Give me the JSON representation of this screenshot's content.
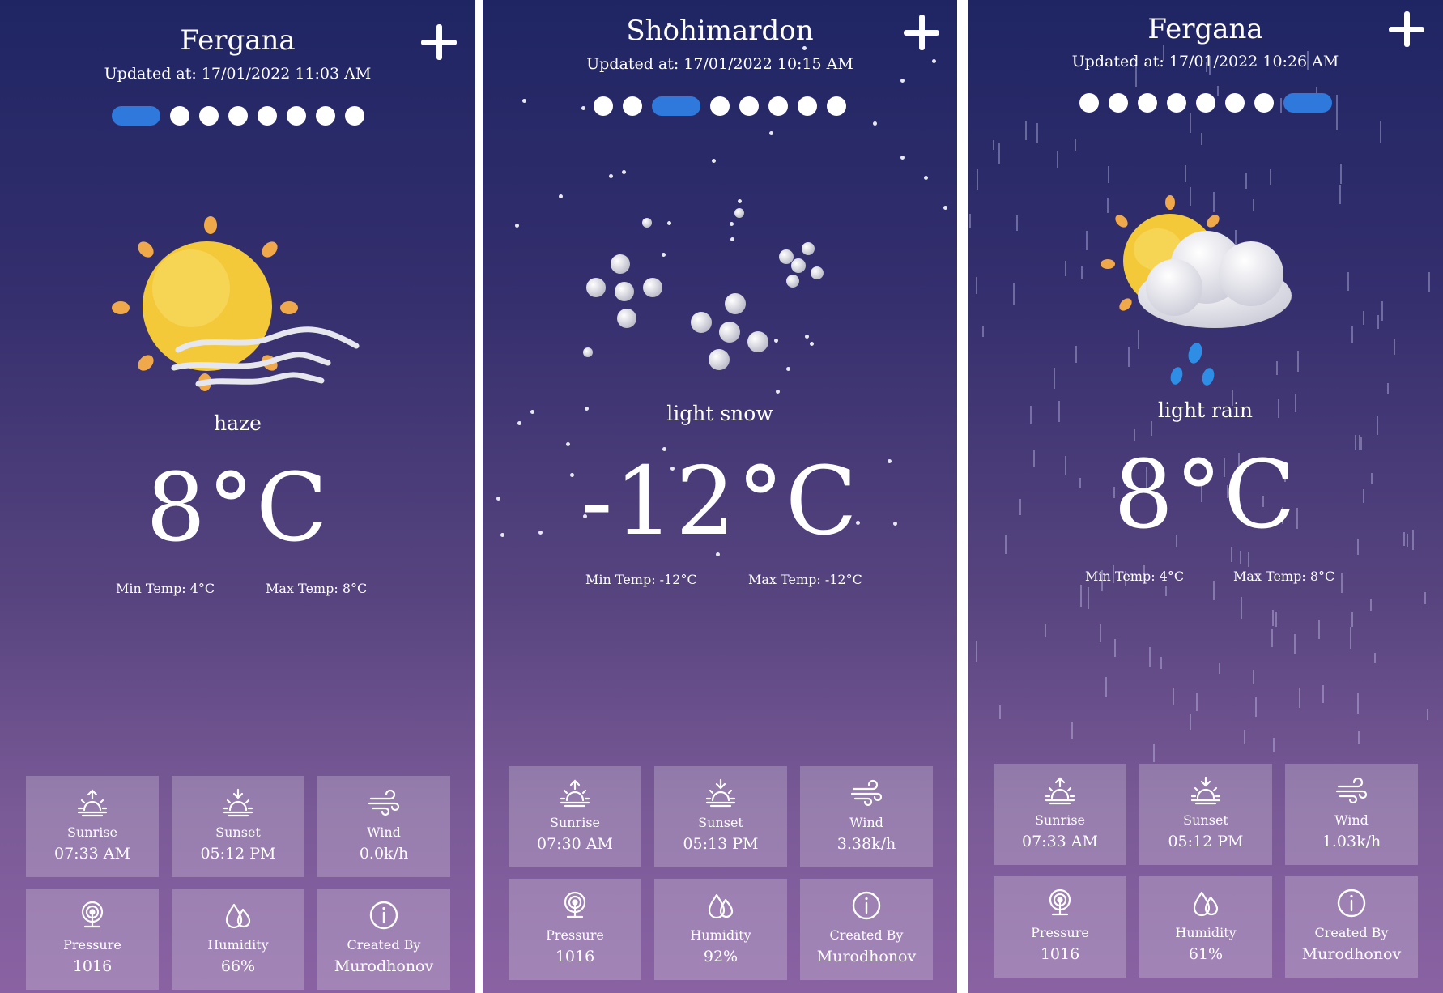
{
  "colors": {
    "active_dot": "#2e79db",
    "sun": "#f3c93a",
    "sun_ray": "#f0a94a",
    "cloud": "#e8e8ef",
    "raindrop": "#2e8ee6"
  },
  "screens": [
    {
      "city": "Fergana",
      "updated": "Updated at: 17/01/2022 11:03 AM",
      "add_icon": "plus-icon",
      "dot_count": 8,
      "active_dot_index": 0,
      "weather_icon": "sun-haze-icon",
      "condition": "haze",
      "temperature": "8°C",
      "min_temp": "Min Temp: 4°C",
      "max_temp": "Max Temp: 8°C",
      "tiles": [
        {
          "icon": "sunrise-icon",
          "label": "Sunrise",
          "value": "07:33 AM"
        },
        {
          "icon": "sunset-icon",
          "label": "Sunset",
          "value": "05:12 PM"
        },
        {
          "icon": "wind-icon",
          "label": "Wind",
          "value": "0.0k/h"
        },
        {
          "icon": "pressure-icon",
          "label": "Pressure",
          "value": "1016"
        },
        {
          "icon": "humidity-icon",
          "label": "Humidity",
          "value": "66%"
        },
        {
          "icon": "info-icon",
          "label": "Created By",
          "value": "Murodhonov"
        }
      ]
    },
    {
      "city": "Shohimardon",
      "updated": "Updated at: 17/01/2022 10:15 AM",
      "add_icon": "plus-icon",
      "dot_count": 8,
      "active_dot_index": 2,
      "weather_icon": "snow-icon",
      "condition": "light snow",
      "temperature": "-12°C",
      "min_temp": "Min Temp: -12°C",
      "max_temp": "Max Temp: -12°C",
      "tiles": [
        {
          "icon": "sunrise-icon",
          "label": "Sunrise",
          "value": "07:30 AM"
        },
        {
          "icon": "sunset-icon",
          "label": "Sunset",
          "value": "05:13 PM"
        },
        {
          "icon": "wind-icon",
          "label": "Wind",
          "value": "3.38k/h"
        },
        {
          "icon": "pressure-icon",
          "label": "Pressure",
          "value": "1016"
        },
        {
          "icon": "humidity-icon",
          "label": "Humidity",
          "value": "92%"
        },
        {
          "icon": "info-icon",
          "label": "Created By",
          "value": "Murodhonov"
        }
      ]
    },
    {
      "city": "Fergana",
      "updated": "Updated at: 17/01/2022 10:26 AM",
      "add_icon": "plus-icon",
      "dot_count": 8,
      "active_dot_index": 7,
      "weather_icon": "sun-cloud-rain-icon",
      "condition": "light rain",
      "temperature": "8°C",
      "min_temp": "Min Temp: 4°C",
      "max_temp": "Max Temp: 8°C",
      "tiles": [
        {
          "icon": "sunrise-icon",
          "label": "Sunrise",
          "value": "07:33 AM"
        },
        {
          "icon": "sunset-icon",
          "label": "Sunset",
          "value": "05:12 PM"
        },
        {
          "icon": "wind-icon",
          "label": "Wind",
          "value": "1.03k/h"
        },
        {
          "icon": "pressure-icon",
          "label": "Pressure",
          "value": "1016"
        },
        {
          "icon": "humidity-icon",
          "label": "Humidity",
          "value": "61%"
        },
        {
          "icon": "info-icon",
          "label": "Created By",
          "value": "Murodhonov"
        }
      ]
    }
  ]
}
